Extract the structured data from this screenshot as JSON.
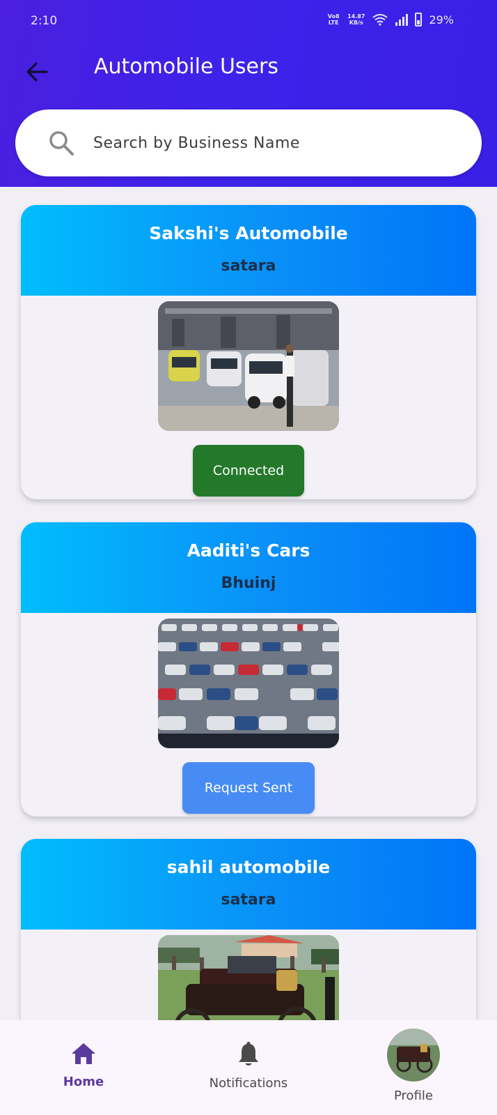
{
  "status_bar": {
    "time": "2:10",
    "net_type": "Vo8 LTE",
    "speed_value": "14.87",
    "speed_unit": "KB/s",
    "battery": "29%"
  },
  "header": {
    "title": "Automobile Users"
  },
  "search": {
    "placeholder": "Search by Business Name"
  },
  "cards": [
    {
      "name": "Sakshi's Automobile",
      "location": "satara",
      "button": "Connected",
      "button_color": "#23782a",
      "image": "factory-cars-photo"
    },
    {
      "name": "Aaditi's Cars",
      "location": "Bhuinj",
      "button": "Request Sent",
      "button_color": "#478cf4",
      "image": "parked-cars-photo"
    },
    {
      "name": "sahil automobile",
      "location": "satara",
      "image": "vintage-car-photo"
    }
  ],
  "bottom_nav": {
    "home": "Home",
    "notifications": "Notifications",
    "profile": "Profile"
  },
  "colors": {
    "header": "#3d22ea",
    "card_gradient_start": "#00bdfc",
    "card_gradient_end": "#0075f7",
    "nav_active": "#5b3a9f"
  }
}
